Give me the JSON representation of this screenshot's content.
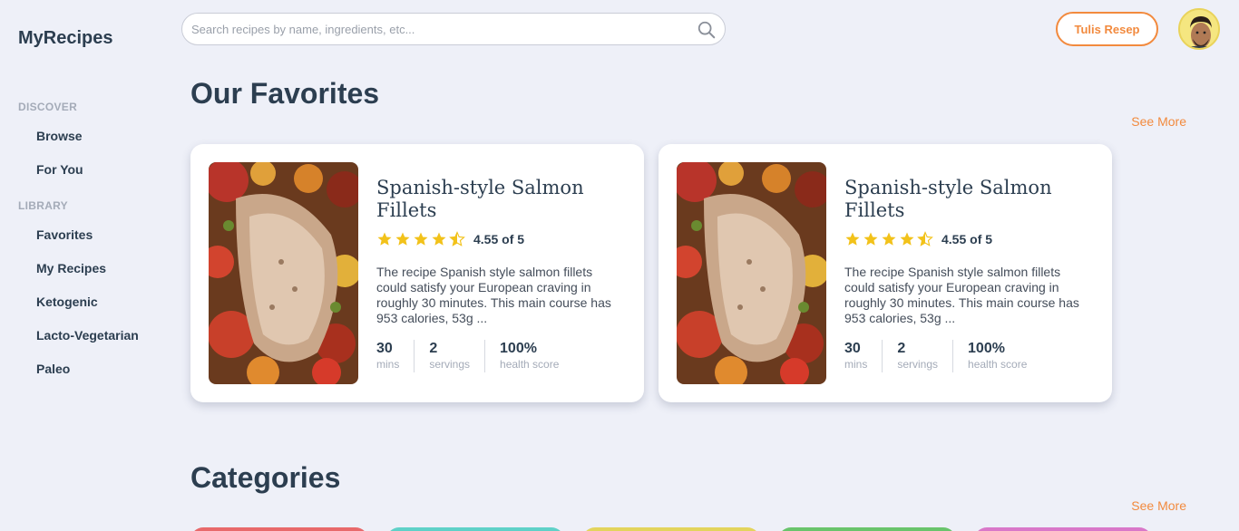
{
  "app": {
    "logo": "MyRecipes"
  },
  "header": {
    "search_placeholder": "Search recipes by name, ingredients, etc...",
    "write_button": "Tulis Resep"
  },
  "sidebar": {
    "discover_label": "DISCOVER",
    "discover_items": [
      "Browse",
      "For You"
    ],
    "library_label": "LIBRARY",
    "library_items": [
      "Favorites",
      "My Recipes",
      "Ketogenic",
      "Lacto-Vegetarian",
      "Paleo"
    ]
  },
  "favorites": {
    "title": "Our Favorites",
    "see_more": "See More",
    "cards": [
      {
        "title": "Spanish-style Salmon Fillets",
        "rating": 4.55,
        "rating_text": "4.55 of 5",
        "description": "The recipe Spanish style salmon fillets could satisfy your European craving in roughly 30 minutes. This main course has 953 calories, 53g ...",
        "stats": [
          {
            "value": "30",
            "unit": "mins"
          },
          {
            "value": "2",
            "unit": "servings"
          },
          {
            "value": "100%",
            "unit": "health score"
          }
        ]
      },
      {
        "title": "Spanish-style Salmon Fillets",
        "rating": 4.55,
        "rating_text": "4.55 of 5",
        "description": "The recipe Spanish style salmon fillets could satisfy your European craving in roughly 30 minutes. This main course has 953 calories, 53g ...",
        "stats": [
          {
            "value": "30",
            "unit": "mins"
          },
          {
            "value": "2",
            "unit": "servings"
          },
          {
            "value": "100%",
            "unit": "health score"
          }
        ]
      }
    ]
  },
  "categories": {
    "title": "Categories",
    "see_more": "See More",
    "colors": [
      "#e8696b",
      "#5fd1c8",
      "#e3d45c",
      "#69c46c",
      "#d978c9"
    ]
  },
  "colors": {
    "accent": "#f28a3e",
    "star": "#f2c21a",
    "text": "#2c3e50"
  }
}
